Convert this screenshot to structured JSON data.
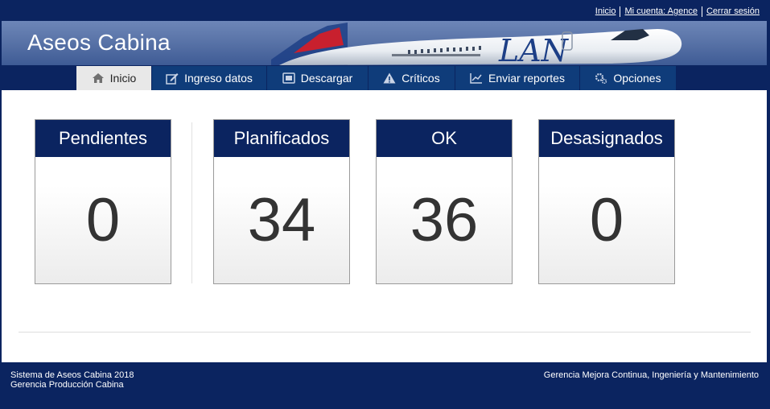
{
  "top_links": {
    "home": "Inicio",
    "account": "Mi cuenta: Agence",
    "logout": "Cerrar sesión"
  },
  "app_title": "Aseos Cabina",
  "banner_logo_text": "LAN",
  "nav": {
    "items": [
      {
        "label": "Inicio",
        "icon": "home-icon",
        "active": true
      },
      {
        "label": "Ingreso datos",
        "icon": "edit-icon"
      },
      {
        "label": "Descargar",
        "icon": "download-icon"
      },
      {
        "label": "Críticos",
        "icon": "warning-icon"
      },
      {
        "label": "Enviar reportes",
        "icon": "chart-icon"
      },
      {
        "label": "Opciones",
        "icon": "gears-icon"
      }
    ]
  },
  "cards": [
    {
      "title": "Pendientes",
      "value": "0"
    },
    {
      "title": "Planificados",
      "value": "34"
    },
    {
      "title": "OK",
      "value": "36"
    },
    {
      "title": "Desasignados",
      "value": "0"
    }
  ],
  "footer": {
    "line1": "Sistema de Aseos Cabina 2018",
    "line2": "Gerencia Producción Cabina",
    "right": "Gerencia Mejora Continua, Ingeniería y Mantenimiento"
  },
  "colors": {
    "navy": "#0b2460",
    "nav_blue": "#0f3c7a",
    "active_tab": "#e8e8e8"
  }
}
